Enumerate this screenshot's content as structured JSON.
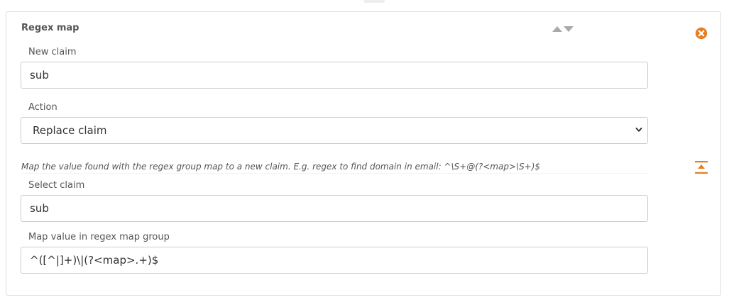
{
  "regex_map": {
    "title": "Regex map",
    "new_claim": {
      "label": "New claim",
      "value": "sub"
    },
    "action": {
      "label": "Action",
      "selected": "Replace claim"
    },
    "hint": "Map the value found with the regex group map to a new claim. E.g. regex to find domain in email: ^\\S+@(?<map>\\S+)$",
    "select_claim": {
      "label": "Select claim",
      "value": "sub"
    },
    "map_value": {
      "label": "Map value in regex map group",
      "value": "^([^|]+)\\|(?<map>.+)$"
    }
  },
  "icons": {
    "move_up": "triangle-up-icon",
    "move_down": "triangle-down-icon",
    "remove": "circle-x-icon",
    "collapse": "collapse-up-icon",
    "dropdown": "chevron-down-icon"
  },
  "colors": {
    "accent": "#e67e22",
    "border": "#cccccc",
    "card_border": "#dcdcdc",
    "arrow": "#a9a9a9"
  }
}
